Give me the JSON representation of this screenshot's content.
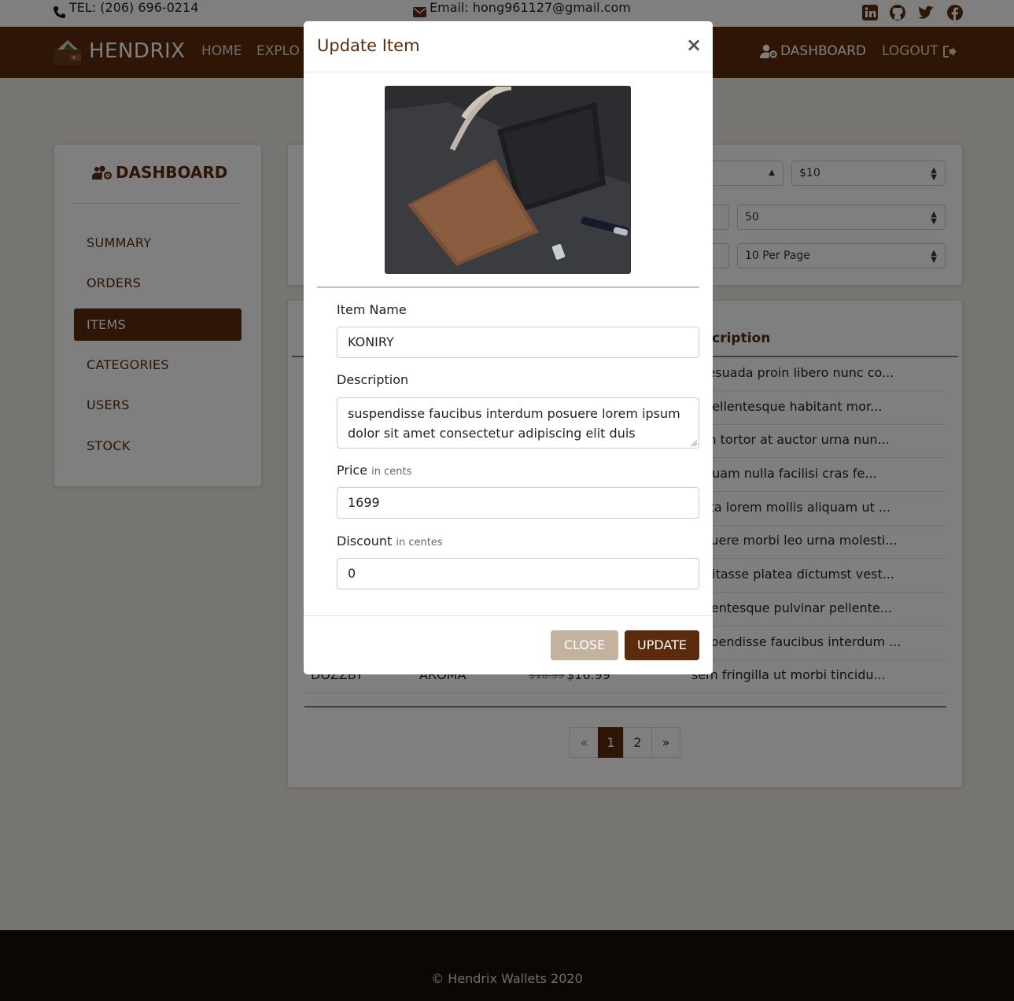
{
  "contact": {
    "tel": "TEL: (206) 696-0214",
    "email": "Email: hong961127@gmail.com"
  },
  "social_icons": [
    "linkedin-icon",
    "github-icon",
    "twitter-icon",
    "facebook-icon"
  ],
  "navbar": {
    "brand": "HENDRIX",
    "links": [
      "HOME",
      "EXPLO"
    ],
    "dashboard": "DASHBOARD",
    "logout": "LOGOUT"
  },
  "sidebar": {
    "title": "DASHBOARD",
    "items": [
      "SUMMARY",
      "ORDERS",
      "ITEMS",
      "CATEGORIES",
      "USERS",
      "STOCK"
    ],
    "active": "ITEMS"
  },
  "filters": {
    "price": "$10",
    "stock": "50",
    "per_page": "10 Per Page"
  },
  "table": {
    "header_desc": "scription",
    "rows": [
      "lesuada proin libero nunc co...",
      " pellentesque habitant mor...",
      "m tortor at auctor urna nun...",
      "quam nulla facilisi cras fe...",
      "rta lorem mollis aliquam ut ...",
      "suere morbi leo urna molesti...",
      "bitasse platea dictumst vest...",
      "llentesque pulvinar pellente...",
      "spendisse faucibus interdum ...",
      "sem fringilla ut morbi tincidu..."
    ],
    "last_row": {
      "name": "DOZZBY",
      "category": "AROMA",
      "old_price": "$18.99",
      "price": "$16.99"
    }
  },
  "pagination": [
    "«",
    "1",
    "2",
    "»"
  ],
  "footer": "© Hendrix Wallets 2020",
  "modal": {
    "title": "Update Item",
    "close_x": "×",
    "name_label": "Item Name",
    "name_value": "KONIRY",
    "desc_label": "Description",
    "desc_value": "suspendisse faucibus interdum posuere lorem ipsum dolor sit amet consectetur adipiscing elit duis tristique sollicitudin",
    "price_label": "Price",
    "price_hint": "in cents",
    "price_value": "1699",
    "discount_label": "Discount",
    "discount_hint": "in centes",
    "discount_value": "0",
    "close_btn": "CLOSE",
    "update_btn": "UPDATE"
  },
  "colors": {
    "brand": "#5c2a0c",
    "footer": "#180f04",
    "close_btn": "#c2b29e"
  }
}
